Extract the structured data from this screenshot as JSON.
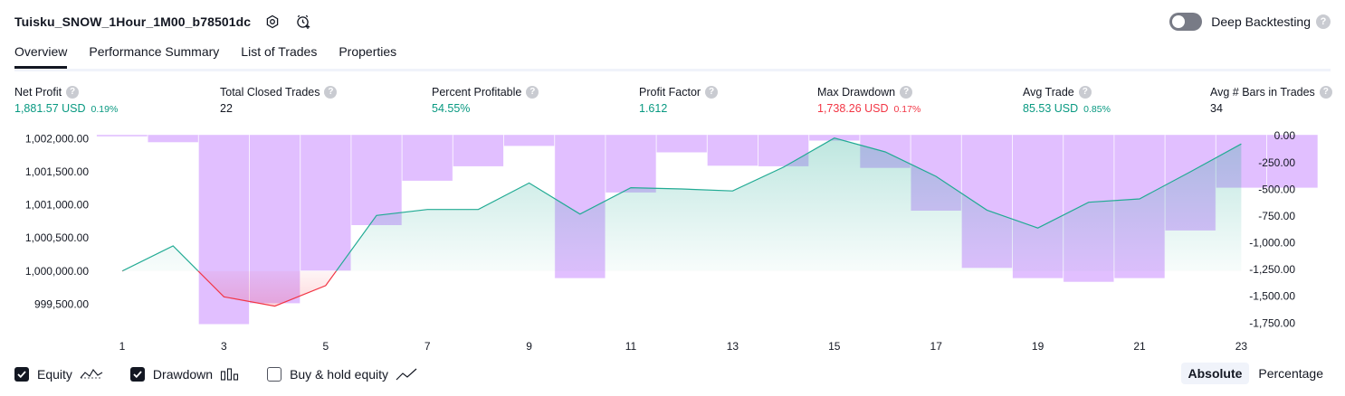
{
  "header": {
    "title": "Tuisku_SNOW_1Hour_1M00_b78501dc",
    "deep_backtesting_label": "Deep Backtesting",
    "help_glyph": "?"
  },
  "tabs": [
    {
      "label": "Overview",
      "active": true
    },
    {
      "label": "Performance Summary",
      "active": false
    },
    {
      "label": "List of Trades",
      "active": false
    },
    {
      "label": "Properties",
      "active": false
    }
  ],
  "metrics": [
    {
      "label": "Net Profit",
      "value": "1,881.57 USD",
      "pct": "0.19%",
      "tone": "pos"
    },
    {
      "label": "Total Closed Trades",
      "value": "22",
      "pct": "",
      "tone": "neu"
    },
    {
      "label": "Percent Profitable",
      "value": "54.55%",
      "pct": "",
      "tone": "pos"
    },
    {
      "label": "Profit Factor",
      "value": "1.612",
      "pct": "",
      "tone": "pos"
    },
    {
      "label": "Max Drawdown",
      "value": "1,738.26 USD",
      "pct": "0.17%",
      "tone": "neg"
    },
    {
      "label": "Avg Trade",
      "value": "85.53 USD",
      "pct": "0.85%",
      "tone": "pos"
    },
    {
      "label": "Avg # Bars in Trades",
      "value": "34",
      "pct": "",
      "tone": "neu"
    }
  ],
  "chart_data": {
    "type": "line",
    "x_ticks": [
      "1",
      "3",
      "5",
      "7",
      "9",
      "11",
      "13",
      "15",
      "17",
      "19",
      "21",
      "23"
    ],
    "left_axis": {
      "ticks": [
        "1,002,000.00",
        "1,001,500.00",
        "1,001,000.00",
        "1,000,500.00",
        "1,000,000.00",
        "999,500.00"
      ],
      "ylim": [
        999150,
        1002060
      ],
      "baseline": 1000000
    },
    "right_axis": {
      "ticks": [
        "0.00",
        "-250.00",
        "-500.00",
        "-750.00",
        "-1,000.00",
        "-1,250.00",
        "-1,500.00",
        "-1,750.00"
      ],
      "ylim": [
        -1790,
        10
      ]
    },
    "series": [
      {
        "key": "equity",
        "x": [
          1,
          2,
          3,
          4,
          5,
          6,
          7,
          8,
          9,
          10,
          11,
          12,
          13,
          14,
          15,
          16,
          17,
          18,
          19,
          20,
          21,
          22,
          23
        ],
        "values": [
          1000000,
          1000380,
          999610,
          999470,
          999780,
          1000840,
          1000930,
          1000930,
          1001330,
          1000860,
          1001260,
          1001240,
          1001210,
          1001570,
          1002010,
          1001800,
          1001430,
          1000920,
          1000650,
          1001040,
          1001090,
          1001500,
          1001920
        ]
      },
      {
        "key": "drawdown",
        "x": [
          1,
          2,
          3,
          4,
          5,
          6,
          7,
          8,
          9,
          10,
          11,
          12,
          13,
          14,
          15,
          16,
          17,
          18,
          19,
          20,
          21,
          22,
          23,
          24
        ],
        "values": [
          -5,
          -60,
          -1760,
          -1565,
          -1260,
          -835,
          -420,
          -285,
          -95,
          -1330,
          -530,
          -155,
          -280,
          -285,
          -45,
          -300,
          -700,
          -1235,
          -1330,
          -1365,
          -1330,
          -885,
          -485,
          -485
        ]
      }
    ],
    "colors": {
      "equity_line": "#22ab94",
      "equity_negative": "#f23645",
      "drawdown_bar": "#e1bfff",
      "label": "#131722"
    }
  },
  "legend": [
    {
      "label": "Equity",
      "checked": true,
      "icon": "equity-line-icon"
    },
    {
      "label": "Drawdown",
      "checked": true,
      "icon": "drawdown-bars-icon"
    },
    {
      "label": "Buy & hold equity",
      "checked": false,
      "icon": "buy-hold-line-icon"
    }
  ],
  "modes": [
    {
      "label": "Absolute",
      "active": true
    },
    {
      "label": "Percentage",
      "active": false
    }
  ]
}
